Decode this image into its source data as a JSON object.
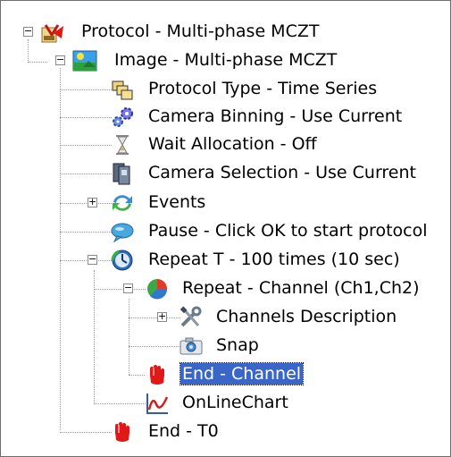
{
  "tree": {
    "items": [
      {
        "label": "Protocol - Multi-phase MCZT",
        "icon": "protocol-icon",
        "toggle": "−"
      },
      {
        "label": "Image - Multi-phase MCZT",
        "icon": "image-icon",
        "toggle": "−"
      },
      {
        "label": "Protocol Type - Time Series",
        "icon": "protocol-type-icon"
      },
      {
        "label": "Camera Binning - Use Current",
        "icon": "camera-binning-icon"
      },
      {
        "label": "Wait Allocation - Off",
        "icon": "hourglass-icon"
      },
      {
        "label": "Camera Selection - Use Current",
        "icon": "camera-selection-icon"
      },
      {
        "label": "Events",
        "icon": "events-icon",
        "toggle": "+"
      },
      {
        "label": "Pause - Click OK to start protocol",
        "icon": "pause-icon"
      },
      {
        "label": "Repeat T - 100 times (10 sec)",
        "icon": "repeat-time-icon",
        "toggle": "−"
      },
      {
        "label": "Repeat - Channel (Ch1,Ch2)",
        "icon": "repeat-channel-icon",
        "toggle": "−"
      },
      {
        "label": "Channels Description",
        "icon": "tools-icon",
        "toggle": "+"
      },
      {
        "label": "Snap",
        "icon": "camera-snap-icon"
      },
      {
        "label": "End - Channel",
        "icon": "end-hand-icon",
        "selected": true
      },
      {
        "label": "OnLineChart",
        "icon": "chart-icon"
      },
      {
        "label": "End - T0",
        "icon": "end-hand-icon"
      }
    ]
  },
  "colors": {
    "selection": "#3a66c8",
    "end_hand": "#e01818",
    "chart_line": "#d02020"
  }
}
